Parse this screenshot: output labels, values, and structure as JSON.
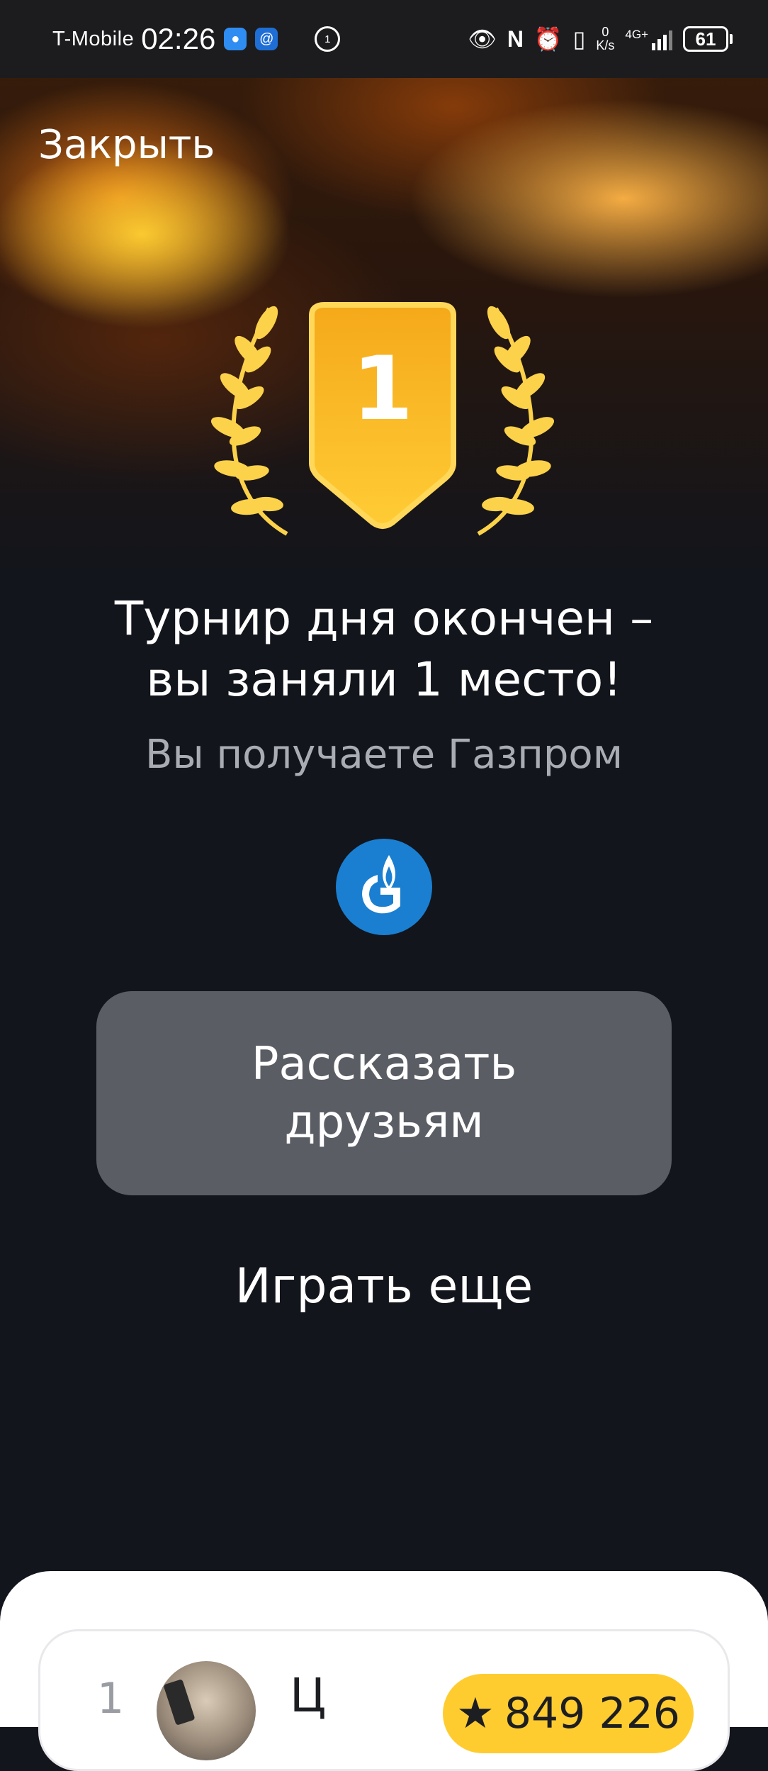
{
  "status_bar": {
    "carrier": "T-Mobile",
    "time": "02:26",
    "ring_badge": "1",
    "net_speed_value": "0",
    "net_speed_unit": "K/s",
    "network_type": "4G+",
    "battery": "61"
  },
  "header": {
    "close_label": "Закрыть"
  },
  "badge": {
    "place_number": "1"
  },
  "result": {
    "headline_line1": "Турнир дня окончен –",
    "headline_line2": "вы заняли 1 место!",
    "subtitle": "Вы получаете Газпром"
  },
  "actions": {
    "share_line1": "Рассказать",
    "share_line2": "друзьям",
    "play_again": "Играть еще"
  },
  "leaderboard": {
    "entries": [
      {
        "rank": "1",
        "name": "Ц",
        "score": "849 226",
        "score_icon": "star-icon"
      }
    ]
  },
  "colors": {
    "background": "#12151c",
    "accent_gold": "#ffcc2f",
    "share_button": "#5a5d64",
    "gazprom_blue": "#1a7fd1"
  }
}
